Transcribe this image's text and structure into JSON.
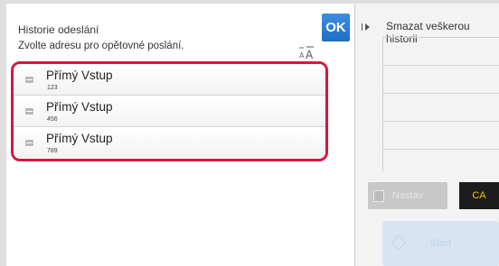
{
  "main": {
    "title": "Historie odeslání",
    "instruction": "Zvolte adresu pro opětovné poslání.",
    "ok_label": "OK",
    "font_toggle_icon": "text-size-icon",
    "entries": [
      {
        "name": "Přímý Vstup",
        "number": "123"
      },
      {
        "name": "Přímý Vstup",
        "number": "456"
      },
      {
        "name": "Přímý Vstup",
        "number": "789"
      }
    ]
  },
  "side": {
    "clear_history_label": "Smazat veškerou historii",
    "reset_label": "Nastav",
    "ca_label": "CA",
    "start_label": "Start"
  },
  "colors": {
    "selection_border": "#d7163d",
    "ok_blue": "#2a7bd3",
    "ca_background": "#1c1c1c",
    "ca_text": "#f5c400"
  }
}
